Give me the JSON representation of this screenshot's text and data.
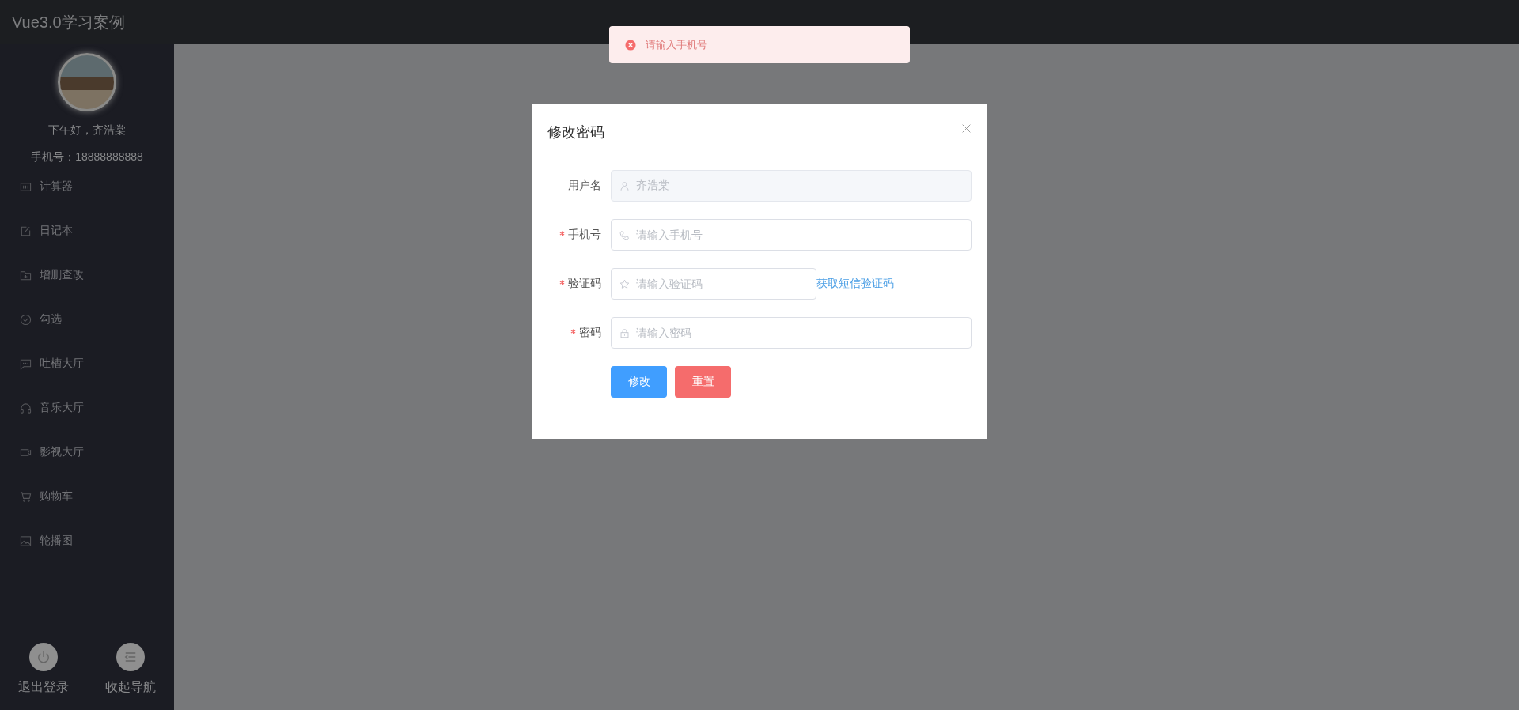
{
  "header": {
    "title": "Vue3.0学习案例"
  },
  "sidebar": {
    "greeting": "下午好，齐浩棠",
    "phone": "手机号：18888888888",
    "menu": [
      {
        "label": "计算器"
      },
      {
        "label": "日记本"
      },
      {
        "label": "增删查改"
      },
      {
        "label": "勾选"
      },
      {
        "label": "吐槽大厅"
      },
      {
        "label": "音乐大厅"
      },
      {
        "label": "影视大厅"
      },
      {
        "label": "购物车"
      },
      {
        "label": "轮播图"
      }
    ],
    "footer": [
      {
        "label": "退出登录"
      },
      {
        "label": "收起导航"
      }
    ]
  },
  "toast": {
    "kind": "error",
    "message": "请输入手机号"
  },
  "dialog": {
    "title": "修改密码",
    "fields": [
      {
        "label": "用户名",
        "required": false,
        "disabled": true,
        "value": "齐浩棠"
      },
      {
        "label": "手机号",
        "required": true,
        "disabled": false,
        "placeholder": "请输入手机号"
      },
      {
        "label": "验证码",
        "required": true,
        "disabled": false,
        "placeholder": "请输入验证码",
        "action": "获取短信验证码"
      },
      {
        "label": "密码",
        "required": true,
        "disabled": false,
        "placeholder": "请输入密码"
      }
    ],
    "buttons": [
      {
        "label": "修改",
        "kind": "primary"
      },
      {
        "label": "重置",
        "kind": "danger"
      }
    ]
  }
}
